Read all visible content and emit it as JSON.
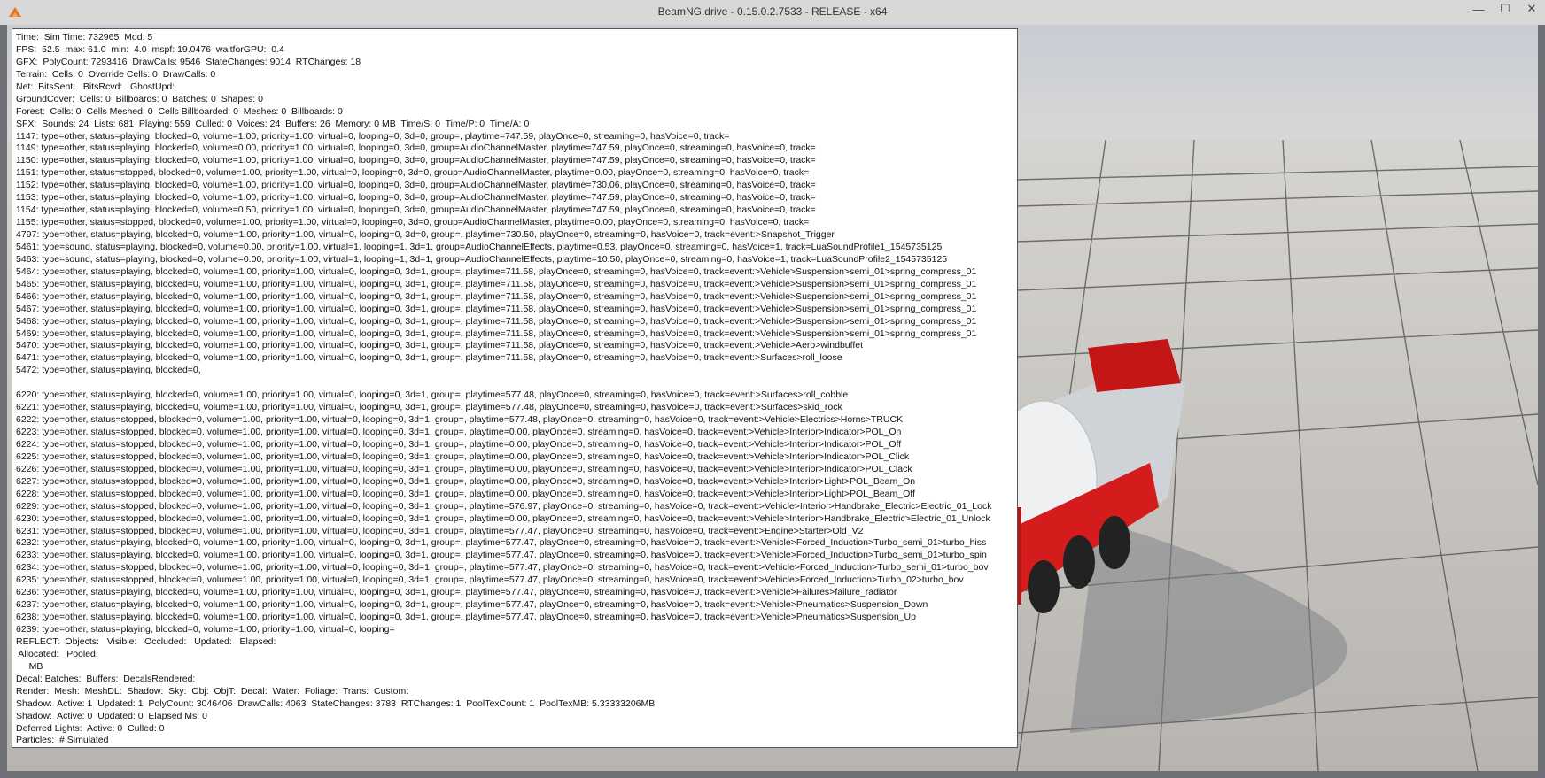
{
  "window": {
    "title": "BeamNG.drive - 0.15.0.2.7533 - RELEASE - x64",
    "controls": {
      "minimize": "—",
      "maximize": "☐",
      "close": "✕"
    }
  },
  "icons": {
    "app": "beamng-logo-icon"
  },
  "colors": {
    "accent": "#e8731e",
    "truck_red": "#cc1a1a",
    "console_bg": "#ffffff"
  },
  "console": {
    "lines": [
      "Time:  Sim Time: 732965  Mod: 5",
      "FPS:  52.5  max: 61.0  min:  4.0  mspf: 19.0476  waitforGPU:  0.4",
      "GFX:  PolyCount: 7293416  DrawCalls: 9546  StateChanges: 9014  RTChanges: 18",
      "Terrain:  Cells: 0  Override Cells: 0  DrawCalls: 0",
      "Net:  BitsSent:   BitsRcvd:   GhostUpd:",
      "GroundCover:  Cells: 0  Billboards: 0  Batches: 0  Shapes: 0",
      "Forest:  Cells: 0  Cells Meshed: 0  Cells Billboarded: 0  Meshes: 0  Billboards: 0",
      "SFX:  Sounds: 24  Lists: 681  Playing: 559  Culled: 0  Voices: 24  Buffers: 26  Memory: 0 MB  Time/S: 0  Time/P: 0  Time/A: 0",
      "1147: type=other, status=playing, blocked=0, volume=1.00, priority=1.00, virtual=0, looping=0, 3d=0, group=, playtime=747.59, playOnce=0, streaming=0, hasVoice=0, track=",
      "1149: type=other, status=playing, blocked=0, volume=0.00, priority=1.00, virtual=0, looping=0, 3d=0, group=AudioChannelMaster, playtime=747.59, playOnce=0, streaming=0, hasVoice=0, track=",
      "1150: type=other, status=playing, blocked=0, volume=1.00, priority=1.00, virtual=0, looping=0, 3d=0, group=AudioChannelMaster, playtime=747.59, playOnce=0, streaming=0, hasVoice=0, track=",
      "1151: type=other, status=stopped, blocked=0, volume=1.00, priority=1.00, virtual=0, looping=0, 3d=0, group=AudioChannelMaster, playtime=0.00, playOnce=0, streaming=0, hasVoice=0, track=",
      "1152: type=other, status=playing, blocked=0, volume=1.00, priority=1.00, virtual=0, looping=0, 3d=0, group=AudioChannelMaster, playtime=730.06, playOnce=0, streaming=0, hasVoice=0, track=",
      "1153: type=other, status=playing, blocked=0, volume=1.00, priority=1.00, virtual=0, looping=0, 3d=0, group=AudioChannelMaster, playtime=747.59, playOnce=0, streaming=0, hasVoice=0, track=",
      "1154: type=other, status=playing, blocked=0, volume=0.50, priority=1.00, virtual=0, looping=0, 3d=0, group=AudioChannelMaster, playtime=747.59, playOnce=0, streaming=0, hasVoice=0, track=",
      "1155: type=other, status=stopped, blocked=0, volume=1.00, priority=1.00, virtual=0, looping=0, 3d=0, group=AudioChannelMaster, playtime=0.00, playOnce=0, streaming=0, hasVoice=0, track=",
      "4797: type=other, status=playing, blocked=0, volume=1.00, priority=1.00, virtual=0, looping=0, 3d=0, group=, playtime=730.50, playOnce=0, streaming=0, hasVoice=0, track=event:>Snapshot_Trigger",
      "5461: type=sound, status=playing, blocked=0, volume=0.00, priority=1.00, virtual=1, looping=1, 3d=1, group=AudioChannelEffects, playtime=0.53, playOnce=0, streaming=0, hasVoice=1, track=LuaSoundProfile1_1545735125",
      "5463: type=sound, status=playing, blocked=0, volume=0.00, priority=1.00, virtual=1, looping=1, 3d=1, group=AudioChannelEffects, playtime=10.50, playOnce=0, streaming=0, hasVoice=1, track=LuaSoundProfile2_1545735125",
      "5464: type=other, status=playing, blocked=0, volume=1.00, priority=1.00, virtual=0, looping=0, 3d=1, group=, playtime=711.58, playOnce=0, streaming=0, hasVoice=0, track=event:>Vehicle>Suspension>semi_01>spring_compress_01",
      "5465: type=other, status=playing, blocked=0, volume=1.00, priority=1.00, virtual=0, looping=0, 3d=1, group=, playtime=711.58, playOnce=0, streaming=0, hasVoice=0, track=event:>Vehicle>Suspension>semi_01>spring_compress_01",
      "5466: type=other, status=playing, blocked=0, volume=1.00, priority=1.00, virtual=0, looping=0, 3d=1, group=, playtime=711.58, playOnce=0, streaming=0, hasVoice=0, track=event:>Vehicle>Suspension>semi_01>spring_compress_01",
      "5467: type=other, status=playing, blocked=0, volume=1.00, priority=1.00, virtual=0, looping=0, 3d=1, group=, playtime=711.58, playOnce=0, streaming=0, hasVoice=0, track=event:>Vehicle>Suspension>semi_01>spring_compress_01",
      "5468: type=other, status=playing, blocked=0, volume=1.00, priority=1.00, virtual=0, looping=0, 3d=1, group=, playtime=711.58, playOnce=0, streaming=0, hasVoice=0, track=event:>Vehicle>Suspension>semi_01>spring_compress_01",
      "5469: type=other, status=playing, blocked=0, volume=1.00, priority=1.00, virtual=0, looping=0, 3d=1, group=, playtime=711.58, playOnce=0, streaming=0, hasVoice=0, track=event:>Vehicle>Suspension>semi_01>spring_compress_01",
      "5470: type=other, status=playing, blocked=0, volume=1.00, priority=1.00, virtual=0, looping=0, 3d=1, group=, playtime=711.58, playOnce=0, streaming=0, hasVoice=0, track=event:>Vehicle>Aero>windbuffet",
      "5471: type=other, status=playing, blocked=0, volume=1.00, priority=1.00, virtual=0, looping=0, 3d=1, group=, playtime=711.58, playOnce=0, streaming=0, hasVoice=0, track=event:>Surfaces>roll_loose",
      "5472: type=other, status=playing, blocked=0,",
      "",
      "6220: type=other, status=playing, blocked=0, volume=1.00, priority=1.00, virtual=0, looping=0, 3d=1, group=, playtime=577.48, playOnce=0, streaming=0, hasVoice=0, track=event:>Surfaces>roll_cobble",
      "6221: type=other, status=playing, blocked=0, volume=1.00, priority=1.00, virtual=0, looping=0, 3d=1, group=, playtime=577.48, playOnce=0, streaming=0, hasVoice=0, track=event:>Surfaces>skid_rock",
      "6222: type=other, status=stopped, blocked=0, volume=1.00, priority=1.00, virtual=0, looping=0, 3d=1, group=, playtime=577.48, playOnce=0, streaming=0, hasVoice=0, track=event:>Vehicle>Electrics>Horns>TRUCK",
      "6223: type=other, status=stopped, blocked=0, volume=1.00, priority=1.00, virtual=0, looping=0, 3d=1, group=, playtime=0.00, playOnce=0, streaming=0, hasVoice=0, track=event:>Vehicle>Interior>Indicator>POL_On",
      "6224: type=other, status=stopped, blocked=0, volume=1.00, priority=1.00, virtual=0, looping=0, 3d=1, group=, playtime=0.00, playOnce=0, streaming=0, hasVoice=0, track=event:>Vehicle>Interior>Indicator>POL_Off",
      "6225: type=other, status=stopped, blocked=0, volume=1.00, priority=1.00, virtual=0, looping=0, 3d=1, group=, playtime=0.00, playOnce=0, streaming=0, hasVoice=0, track=event:>Vehicle>Interior>Indicator>POL_Click",
      "6226: type=other, status=stopped, blocked=0, volume=1.00, priority=1.00, virtual=0, looping=0, 3d=1, group=, playtime=0.00, playOnce=0, streaming=0, hasVoice=0, track=event:>Vehicle>Interior>Indicator>POL_Clack",
      "6227: type=other, status=stopped, blocked=0, volume=1.00, priority=1.00, virtual=0, looping=0, 3d=1, group=, playtime=0.00, playOnce=0, streaming=0, hasVoice=0, track=event:>Vehicle>Interior>Light>POL_Beam_On",
      "6228: type=other, status=stopped, blocked=0, volume=1.00, priority=1.00, virtual=0, looping=0, 3d=1, group=, playtime=0.00, playOnce=0, streaming=0, hasVoice=0, track=event:>Vehicle>Interior>Light>POL_Beam_Off",
      "6229: type=other, status=stopped, blocked=0, volume=1.00, priority=1.00, virtual=0, looping=0, 3d=1, group=, playtime=576.97, playOnce=0, streaming=0, hasVoice=0, track=event:>Vehicle>Interior>Handbrake_Electric>Electric_01_Lock",
      "6230: type=other, status=stopped, blocked=0, volume=1.00, priority=1.00, virtual=0, looping=0, 3d=1, group=, playtime=0.00, playOnce=0, streaming=0, hasVoice=0, track=event:>Vehicle>Interior>Handbrake_Electric>Electric_01_Unlock",
      "6231: type=other, status=stopped, blocked=0, volume=1.00, priority=1.00, virtual=0, looping=0, 3d=1, group=, playtime=577.47, playOnce=0, streaming=0, hasVoice=0, track=event:>Engine>Starter>Old_V2",
      "6232: type=other, status=playing, blocked=0, volume=1.00, priority=1.00, virtual=0, looping=0, 3d=1, group=, playtime=577.47, playOnce=0, streaming=0, hasVoice=0, track=event:>Vehicle>Forced_Induction>Turbo_semi_01>turbo_hiss",
      "6233: type=other, status=playing, blocked=0, volume=1.00, priority=1.00, virtual=0, looping=0, 3d=1, group=, playtime=577.47, playOnce=0, streaming=0, hasVoice=0, track=event:>Vehicle>Forced_Induction>Turbo_semi_01>turbo_spin",
      "6234: type=other, status=stopped, blocked=0, volume=1.00, priority=1.00, virtual=0, looping=0, 3d=1, group=, playtime=577.47, playOnce=0, streaming=0, hasVoice=0, track=event:>Vehicle>Forced_Induction>Turbo_semi_01>turbo_bov",
      "6235: type=other, status=stopped, blocked=0, volume=1.00, priority=1.00, virtual=0, looping=0, 3d=1, group=, playtime=577.47, playOnce=0, streaming=0, hasVoice=0, track=event:>Vehicle>Forced_Induction>Turbo_02>turbo_bov",
      "6236: type=other, status=playing, blocked=0, volume=1.00, priority=1.00, virtual=0, looping=0, 3d=1, group=, playtime=577.47, playOnce=0, streaming=0, hasVoice=0, track=event:>Vehicle>Failures>failure_radiator",
      "6237: type=other, status=playing, blocked=0, volume=1.00, priority=1.00, virtual=0, looping=0, 3d=1, group=, playtime=577.47, playOnce=0, streaming=0, hasVoice=0, track=event:>Vehicle>Pneumatics>Suspension_Down",
      "6238: type=other, status=playing, blocked=0, volume=1.00, priority=1.00, virtual=0, looping=0, 3d=1, group=, playtime=577.47, playOnce=0, streaming=0, hasVoice=0, track=event:>Vehicle>Pneumatics>Suspension_Up",
      "6239: type=other, status=playing, blocked=0, volume=1.00, priority=1.00, virtual=0, looping=",
      "REFLECT:  Objects:   Visible:   Occluded:   Updated:   Elapsed:",
      " Allocated:   Pooled:",
      "     MB",
      "Decal: Batches:  Buffers:  DecalsRendered:",
      "Render:  Mesh:  MeshDL:  Shadow:  Sky:  Obj:  ObjT:  Decal:  Water:  Foliage:  Trans:  Custom:",
      "Shadow:  Active: 1  Updated: 1  PolyCount: 3046406  DrawCalls: 4063  StateChanges: 3783  RTChanges: 1  PoolTexCount: 1  PoolTexMB: 5.33333206MB",
      "Shadow:  Active: 0  Updated: 0  Elapsed Ms: 0",
      "Deferred Lights:  Active: 0  Culled: 0",
      "Particles:  # Simulated"
    ]
  }
}
